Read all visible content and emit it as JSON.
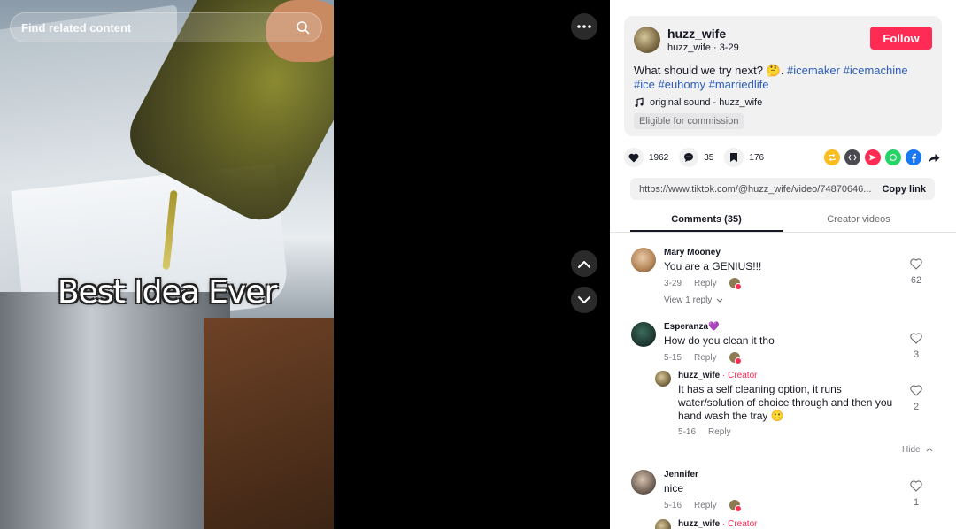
{
  "video": {
    "overlay_text": "Best Idea Ever",
    "search_placeholder": "Find related content"
  },
  "post": {
    "author_name": "huzz_wife",
    "author_handle_date": "huzz_wife · 3-29",
    "follow_label": "Follow",
    "description_prefix": "What should we try next? 🤔.",
    "hashtags": [
      "#icemaker",
      "#icemachine",
      "#ice",
      "#euhomy",
      "#marriedlife"
    ],
    "sound": "original sound - huzz_wife",
    "badge": "Eligible for commission"
  },
  "actions": {
    "likes": "1962",
    "comments": "35",
    "saves": "176"
  },
  "share": {
    "link": "https://www.tiktok.com/@huzz_wife/video/74870646...",
    "copy_label": "Copy link"
  },
  "tabs": {
    "comments": "Comments (35)",
    "creator_videos": "Creator videos"
  },
  "comments": [
    {
      "name": "Mary Mooney",
      "text": "You are a GENIUS!!!",
      "date": "3-29",
      "reply": "Reply",
      "likes": "62",
      "view_replies": "View 1 reply"
    },
    {
      "name": "Esperanza💜",
      "text": "How do you clean it tho",
      "date": "5-15",
      "reply": "Reply",
      "likes": "3"
    },
    {
      "name": "huzz_wife",
      "creator": "· Creator",
      "text": "It has a self cleaning option, it runs water/solution of choice through and then you hand wash the tray 🙂",
      "date": "5-16",
      "reply": "Reply",
      "likes": "2",
      "hide": "Hide"
    },
    {
      "name": "Jennifer",
      "text": "nice",
      "date": "5-16",
      "reply": "Reply",
      "likes": "1"
    },
    {
      "name": "huzz_wife",
      "creator": "· Creator"
    }
  ],
  "colors": {
    "follow": "#fe2c55",
    "hashtag": "#2b5db9",
    "creator": "#fe2c55"
  }
}
